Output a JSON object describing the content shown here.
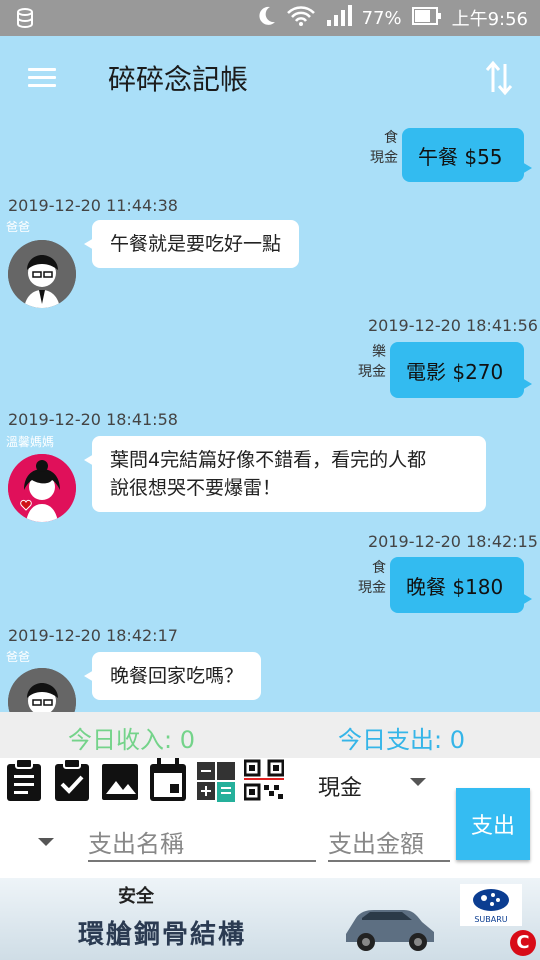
{
  "status_bar": {
    "battery": "77%",
    "time": "上午9:56"
  },
  "app": {
    "title": "碎碎念記帳"
  },
  "messages": [
    {
      "type": "out",
      "category": "食",
      "payment": "現金",
      "text": "午餐 $55"
    },
    {
      "type": "in",
      "time": "2019-12-20 11:44:38",
      "sender": "爸爸",
      "text": "午餐就是要吃好一點"
    },
    {
      "type": "out",
      "time": "2019-12-20 18:41:56",
      "category": "樂",
      "payment": "現金",
      "text": "電影 $270"
    },
    {
      "type": "in",
      "time": "2019-12-20 18:41:58",
      "sender": "溫馨媽媽",
      "text_line1": "葉問4完結篇好像不錯看，看完的人都",
      "text_line2": "說很想哭不要爆雷！"
    },
    {
      "type": "out",
      "time": "2019-12-20 18:42:15",
      "category": "食",
      "payment": "現金",
      "text": "晚餐 $180"
    },
    {
      "type": "in",
      "time": "2019-12-20 18:42:17",
      "sender": "爸爸",
      "text": "晚餐回家吃嗎？"
    }
  ],
  "summary": {
    "income": "今日收入: 0",
    "expense": "今日支出: 0"
  },
  "input": {
    "payment_method": "現金",
    "name_placeholder": "支出名稱",
    "amount_placeholder": "支出金額",
    "submit_label": "支出"
  },
  "ad": {
    "tagline": "安全",
    "slogan": "環艙鋼骨結構",
    "brand": "SUBARU"
  },
  "colors": {
    "chat_bg": "#aadff8",
    "out_bubble": "#33bbf0",
    "income": "#74d38a",
    "expense": "#35b5e8",
    "status_bar": "#999999"
  }
}
